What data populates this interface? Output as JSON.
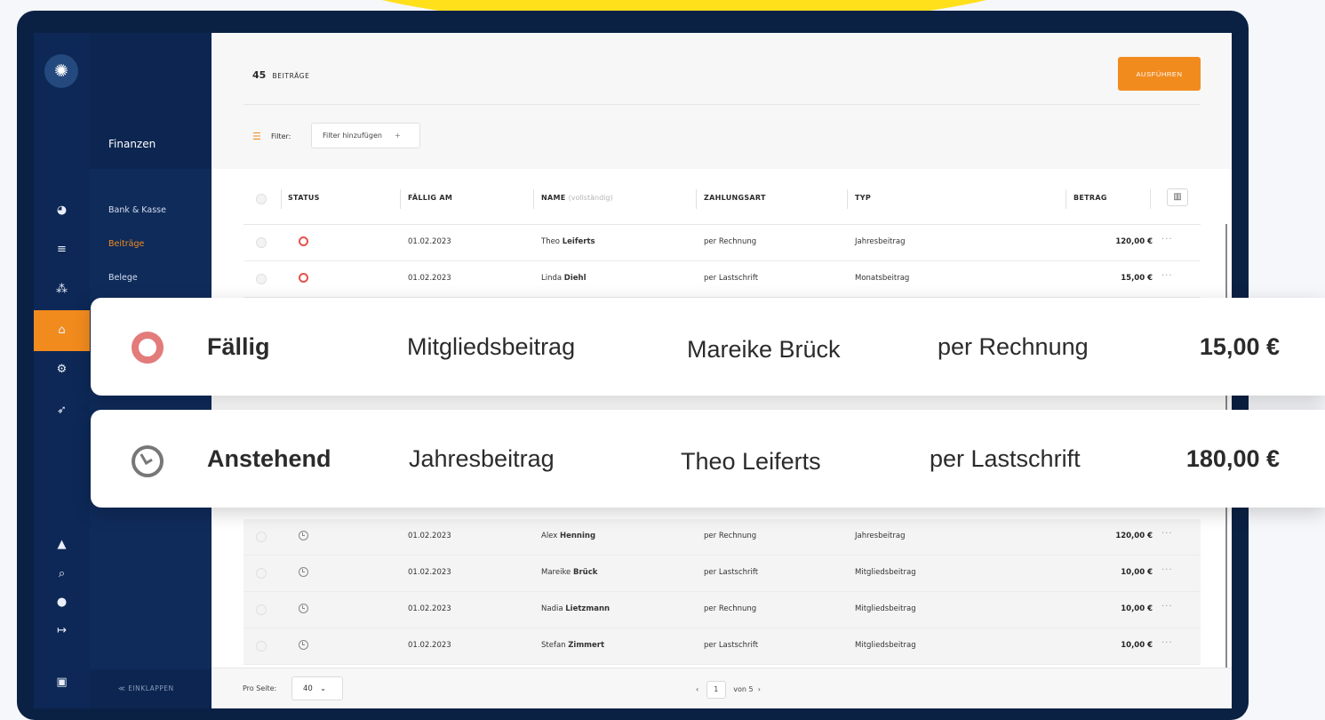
{
  "app": {
    "section_title": "Finanzen"
  },
  "rail": {
    "logo": "✺",
    "icons": [
      "dashboard-icon",
      "list-icon",
      "structure-icon",
      "bank-icon",
      "gear-icon",
      "megaphone-icon",
      "bell-icon",
      "search-icon",
      "info-icon",
      "logout-icon",
      "chat-icon"
    ]
  },
  "subnav": {
    "items": [
      "Bank & Kasse",
      "Beiträge",
      "Belege"
    ],
    "collapse": "≪ EINKLAPPEN"
  },
  "header": {
    "count": "45",
    "count_label": "BEITRÄGE",
    "run_label": "AUSFÜHREN"
  },
  "filter": {
    "label": "Filter:",
    "add": "Filter hinzufügen",
    "add_icon": "+"
  },
  "table": {
    "columns": {
      "status": "STATUS",
      "due": "FÄLLIG AM",
      "name": "NAME",
      "name_hint": "(vollständig)",
      "payment": "ZAHLUNGSART",
      "type": "TYP",
      "amount": "BETRAG"
    },
    "rows": [
      {
        "status": "due",
        "date": "01.02.2023",
        "first": "Theo",
        "last": "Leiferts",
        "payment": "per Rechnung",
        "type": "Jahresbeitrag",
        "amount": "120,00  €"
      },
      {
        "status": "due",
        "date": "01.02.2023",
        "first": "Linda",
        "last": "Diehl",
        "payment": "per Lastschrift",
        "type": "Monatsbeitrag",
        "amount": "15,00  €"
      },
      {
        "status": "pending",
        "date": "01.02.2023",
        "first": "Alex",
        "last": "Henning",
        "payment": "per Rechnung",
        "type": "Jahresbeitrag",
        "amount": "120,00  €"
      },
      {
        "status": "pending",
        "date": "01.02.2023",
        "first": "Mareike",
        "last": "Brück",
        "payment": "per Lastschrift",
        "type": "Mitgliedsbeitrag",
        "amount": "10,00  €"
      },
      {
        "status": "pending",
        "date": "01.02.2023",
        "first": "Nadia",
        "last": "Lietzmann",
        "payment": "per Rechnung",
        "type": "Mitgliedsbeitrag",
        "amount": "10,00  €"
      },
      {
        "status": "pending",
        "date": "01.02.2023",
        "first": "Stefan",
        "last": "Zimmert",
        "payment": "per Lastschrift",
        "type": "Mitgliedsbeitrag",
        "amount": "10,00  €"
      }
    ]
  },
  "cards": [
    {
      "status": "Fällig",
      "type": "Mitgliedsbeitrag",
      "name": "Mareike Brück",
      "payment": "per Rechnung",
      "amount": "15,00  €"
    },
    {
      "status": "Anstehend",
      "type": "Jahresbeitrag",
      "name": "Theo Leiferts",
      "payment": "per Lastschrift",
      "amount": "180,00  €"
    }
  ],
  "footer": {
    "per_page_label": "Pro Seite:",
    "per_page": "40",
    "page": "1",
    "of": "von 5",
    "prev": "‹",
    "next": "›",
    "dropdown": "⌄"
  },
  "colors": {
    "accent": "#f28b1e",
    "navy": "#0b2144",
    "due": "#e5524b"
  }
}
